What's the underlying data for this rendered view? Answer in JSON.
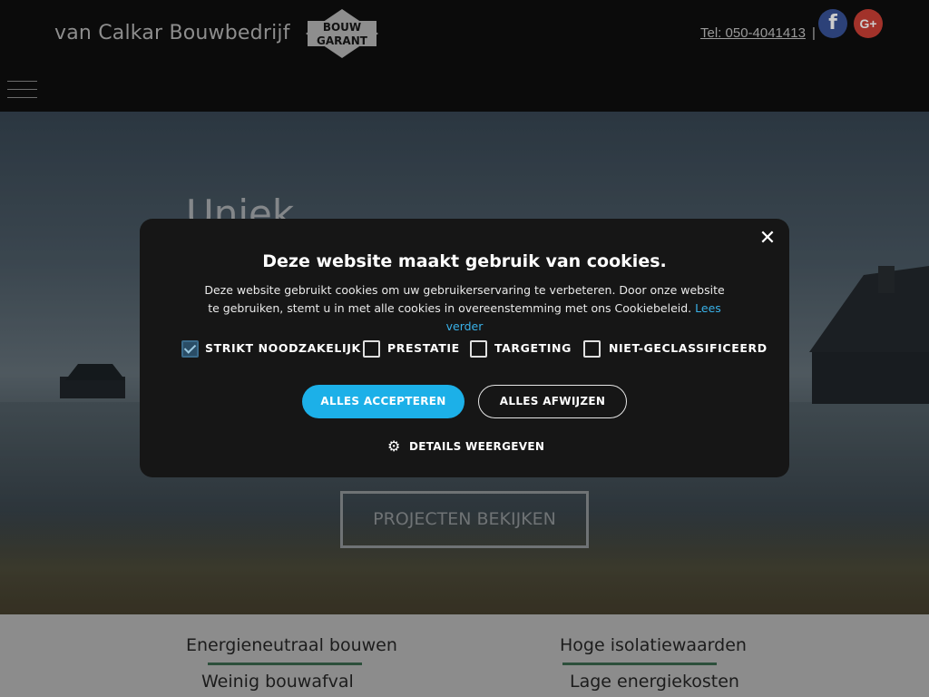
{
  "header": {
    "brand": "van Calkar Bouwbedrijf",
    "logo_text_top": "BOUW",
    "logo_text_bottom": "GARANT",
    "phone": "Tel: 050-4041413",
    "separator": "|",
    "facebook_label": "f",
    "googleplus_label": "G+"
  },
  "hero": {
    "title": "Uniek",
    "cta": "PROJECTEN BEKIJKEN"
  },
  "features": {
    "left_1": "Energieneutraal bouwen",
    "left_2": "Weinig bouwafval",
    "right_1": "Hoge isolatiewaarden",
    "right_2": "Lage energiekosten"
  },
  "cookie_dialog": {
    "title": "Deze website maakt gebruik van cookies.",
    "body": "Deze website gebruikt cookies om uw gebruikerservaring te verbeteren. Door onze website te gebruiken, stemt u in met alle cookies in overeenstemming met ons Cookiebeleid.",
    "link": "Lees verder",
    "close": "✕",
    "categories": [
      {
        "label": "STRIKT NOODZAKELIJK",
        "checked": true
      },
      {
        "label": "PRESTATIE",
        "checked": false
      },
      {
        "label": "TARGETING",
        "checked": false
      },
      {
        "label": "NIET-GECLASSIFICEERD",
        "checked": false
      }
    ],
    "accept_button": "ALLES ACCEPTEREN",
    "reject_button": "ALLES AFWIJZEN",
    "details": "DETAILS WEERGEVEN"
  },
  "colors": {
    "accent": "#1cb0e8",
    "link": "#39b1e8",
    "dialog_bg": "#161616",
    "feature_underline": "#2c4f3b"
  }
}
